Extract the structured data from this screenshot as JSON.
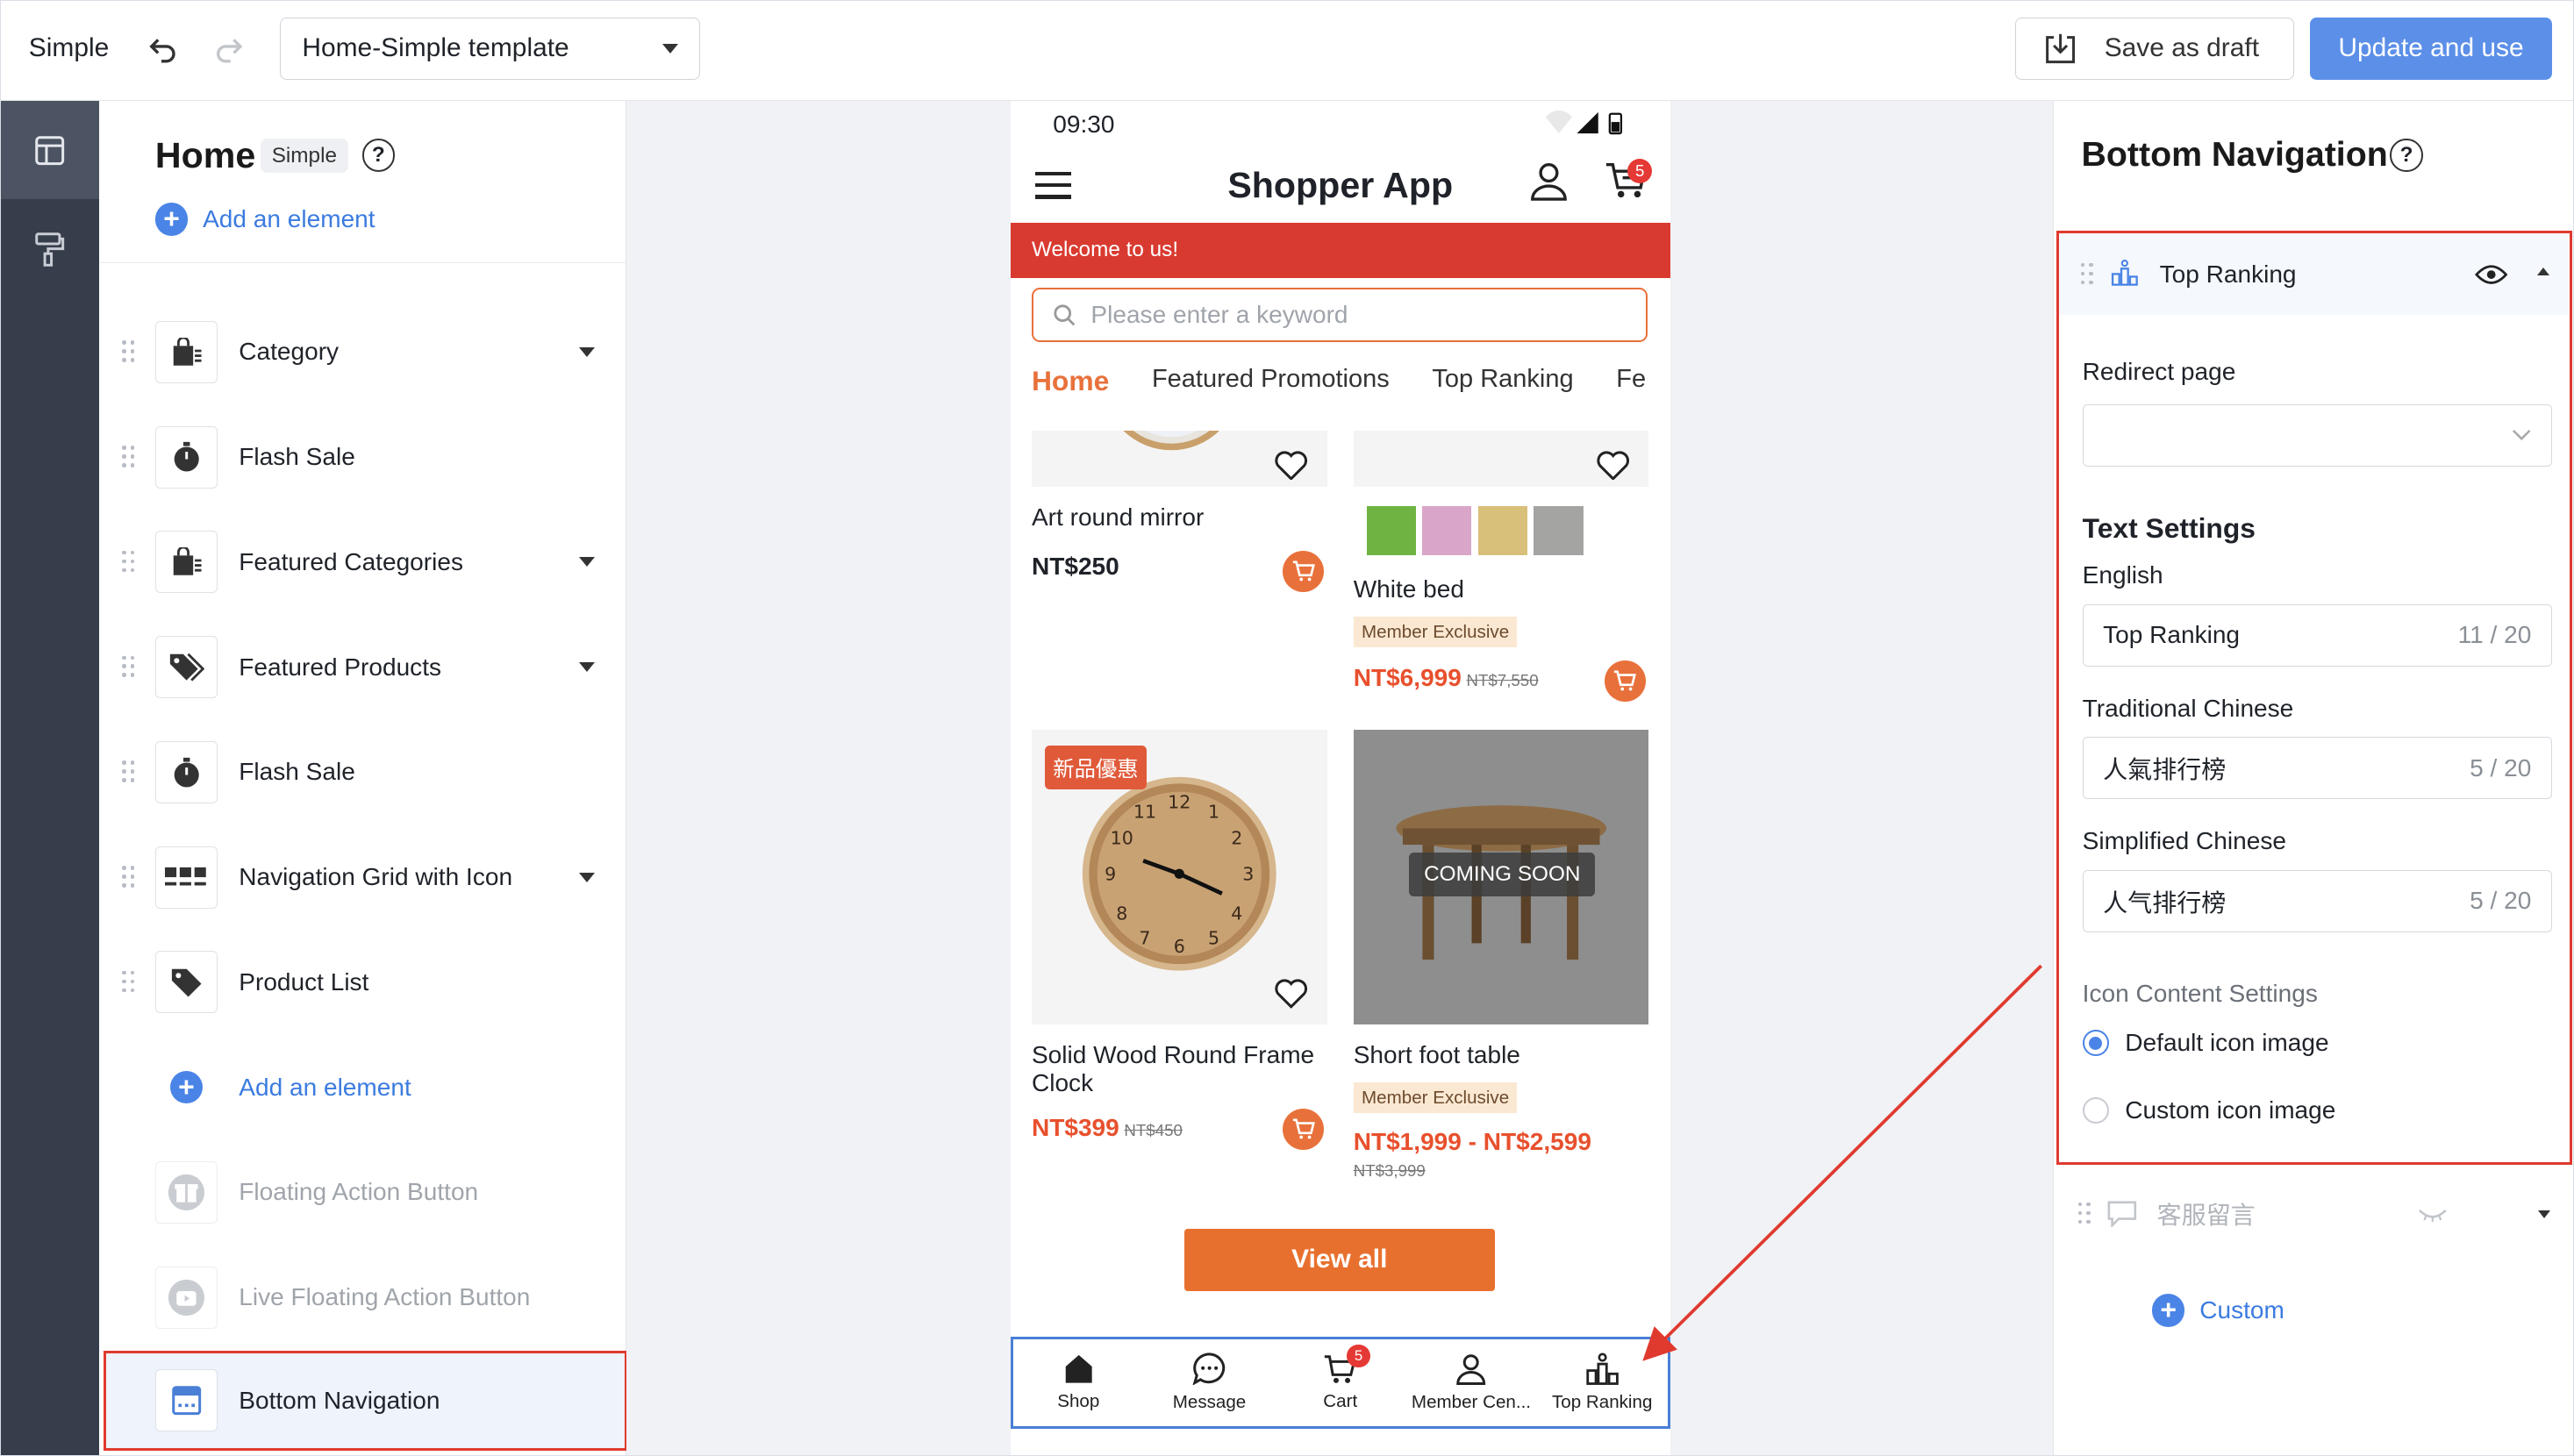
{
  "topbar": {
    "title": "Simple",
    "template_select": "Home-Simple template",
    "save_draft": "Save as draft",
    "update": "Update and use"
  },
  "left_panel": {
    "title": "Home",
    "badge": "Simple",
    "help": "?",
    "add_element": "Add an element",
    "items": [
      {
        "label": "Category",
        "icon": "shop-bag-icon",
        "has_dropdown": true
      },
      {
        "label": "Flash Sale",
        "icon": "stopwatch-icon",
        "has_dropdown": false
      },
      {
        "label": "Featured Categories",
        "icon": "shop-bag-icon",
        "has_dropdown": true
      },
      {
        "label": "Featured Products",
        "icon": "tags-icon",
        "has_dropdown": true
      },
      {
        "label": "Flash Sale",
        "icon": "stopwatch-icon",
        "has_dropdown": false
      },
      {
        "label": "Navigation Grid with Icon",
        "icon": "grid-icon",
        "has_dropdown": true
      },
      {
        "label": "Product List",
        "icon": "tag-icon",
        "has_dropdown": false
      }
    ],
    "add_element_bottom": "Add an element",
    "floating_action": "Floating Action Button",
    "live_floating_action": "Live Floating Action Button",
    "bottom_navigation": "Bottom Navigation"
  },
  "phone": {
    "time": "09:30",
    "app_title": "Shopper App",
    "cart_count": "5",
    "welcome": "Welcome to us!",
    "search_placeholder": "Please enter a keyword",
    "tabs": [
      "Home",
      "Featured Promotions",
      "Top Ranking",
      "Fe"
    ],
    "products": [
      {
        "name": "Art round mirror",
        "price": "NT$250"
      },
      {
        "name": "White bed",
        "badge": "Member Exclusive",
        "price": "NT$6,999",
        "old_price": "NT$7,550"
      },
      {
        "name": "Solid Wood Round Frame Clock",
        "tag": "新品優惠",
        "price": "NT$399",
        "old_price": "NT$450"
      },
      {
        "name": "Short foot table",
        "overlay": "COMING SOON",
        "badge": "Member Exclusive",
        "price": "NT$1,999 - NT$2,599",
        "old_price": "NT$3,999"
      }
    ],
    "swatch_colors": [
      "#6fb443",
      "#d9a6c9",
      "#d8c07a",
      "#a4a4a2"
    ],
    "view_all": "View all",
    "bottom_nav": [
      {
        "label": "Shop",
        "icon": "home-icon"
      },
      {
        "label": "Message",
        "icon": "chat-icon"
      },
      {
        "label": "Cart",
        "icon": "cart-icon",
        "badge": "5"
      },
      {
        "label": "Member Cen...",
        "icon": "user-icon"
      },
      {
        "label": "Top Ranking",
        "icon": "ranking-icon"
      }
    ]
  },
  "right_panel": {
    "title": "Bottom Navigation",
    "help": "?",
    "item_title": "Top Ranking",
    "redirect_label": "Redirect page",
    "redirect_value": "",
    "text_settings": "Text Settings",
    "english_label": "English",
    "english_value": "Top Ranking",
    "english_count": "11 / 20",
    "trad_label": "Traditional Chinese",
    "trad_value": "人氣排行榜",
    "trad_count": "5 / 20",
    "simp_label": "Simplified Chinese",
    "simp_value": "人气排行榜",
    "simp_count": "5 / 20",
    "icon_settings": "Icon Content Settings",
    "default_icon": "Default icon image",
    "custom_icon": "Custom icon image",
    "customer_service": "客服留言",
    "custom": "Custom"
  },
  "colors": {
    "accent_blue": "#4a84e6",
    "highlight_red": "#e03a2f",
    "brand_orange": "#e8713b",
    "rail_dark": "#363d4b"
  }
}
